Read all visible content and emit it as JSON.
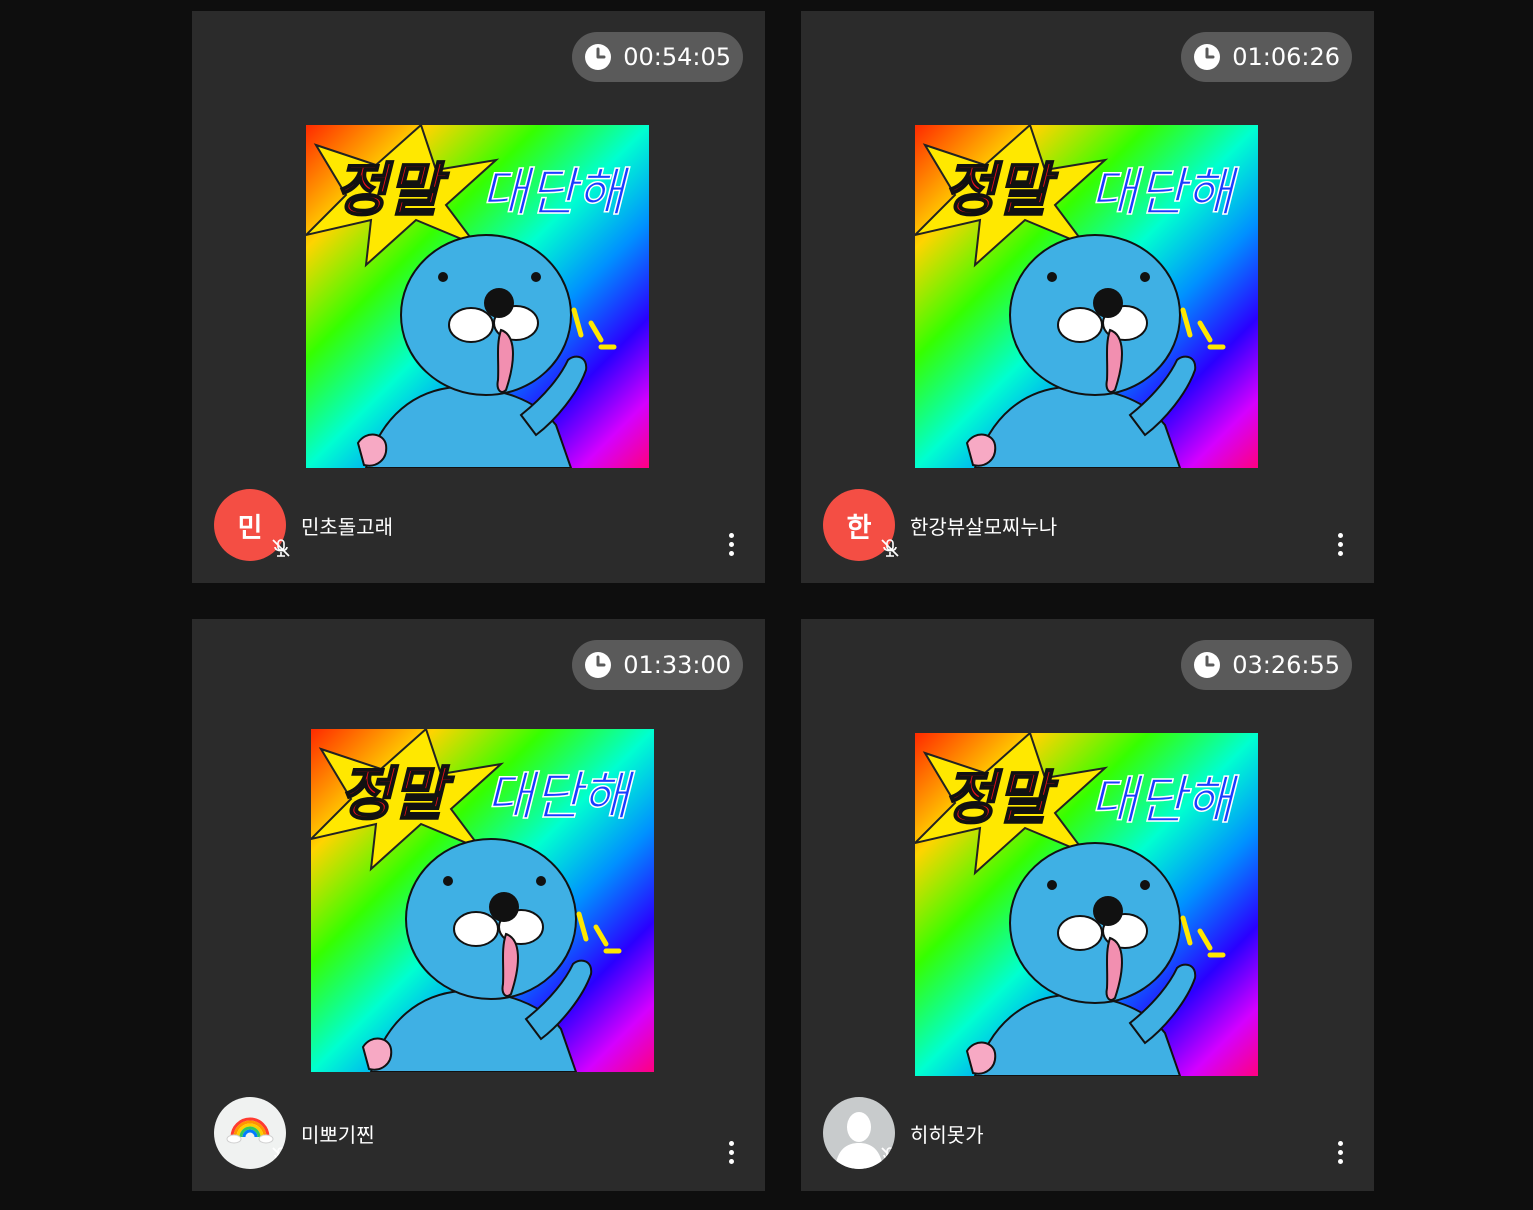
{
  "participants": [
    {
      "timer": "00:54:05",
      "avatar_initial": "민",
      "avatar_type": "initial",
      "name": "민초돌고래"
    },
    {
      "timer": "01:06:26",
      "avatar_initial": "한",
      "avatar_type": "initial",
      "name": "한강뷰살모찌누나"
    },
    {
      "timer": "01:33:00",
      "avatar_initial": "",
      "avatar_type": "rainbow-image",
      "name": "미뽀기찐"
    },
    {
      "timer": "03:26:55",
      "avatar_initial": "",
      "avatar_type": "default-silhouette",
      "name": "히히못가"
    }
  ],
  "sticker": {
    "text_red": "정말",
    "text_blue": "대단해",
    "character": "blue seal (Bonobono) pointing"
  },
  "colors": {
    "background": "#0e0e0e",
    "card": "#2b2b2b",
    "timer_pill": "#5a5a5a",
    "avatar_red": "#f44e44"
  },
  "icons": {
    "timer": "clock-icon",
    "mic": "mic-off-icon",
    "menu": "more-vertical-icon"
  }
}
